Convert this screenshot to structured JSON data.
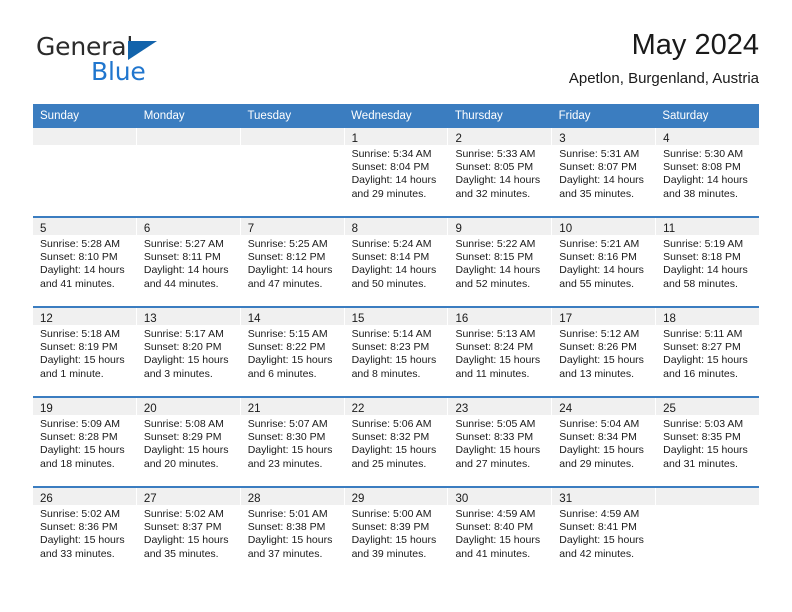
{
  "logo": {
    "word_top": "General",
    "word_bottom": "Blue",
    "triangle_color": "#1263ab",
    "blue_text_color": "#2076ce"
  },
  "header": {
    "title": "May 2024",
    "subtitle": "Apetlon, Burgenland, Austria"
  },
  "colors": {
    "header_blue": "#3b7dc0",
    "day_band_gray": "#f0f0f0",
    "text": "#1a1a1a"
  },
  "weekdays": [
    "Sunday",
    "Monday",
    "Tuesday",
    "Wednesday",
    "Thursday",
    "Friday",
    "Saturday"
  ],
  "weeks": [
    [
      {
        "day": "",
        "empty": true
      },
      {
        "day": "",
        "empty": true
      },
      {
        "day": "",
        "empty": true
      },
      {
        "day": "1",
        "sunrise": "Sunrise: 5:34 AM",
        "sunset": "Sunset: 8:04 PM",
        "daylight_1": "Daylight: 14 hours",
        "daylight_2": "and 29 minutes."
      },
      {
        "day": "2",
        "sunrise": "Sunrise: 5:33 AM",
        "sunset": "Sunset: 8:05 PM",
        "daylight_1": "Daylight: 14 hours",
        "daylight_2": "and 32 minutes."
      },
      {
        "day": "3",
        "sunrise": "Sunrise: 5:31 AM",
        "sunset": "Sunset: 8:07 PM",
        "daylight_1": "Daylight: 14 hours",
        "daylight_2": "and 35 minutes."
      },
      {
        "day": "4",
        "sunrise": "Sunrise: 5:30 AM",
        "sunset": "Sunset: 8:08 PM",
        "daylight_1": "Daylight: 14 hours",
        "daylight_2": "and 38 minutes."
      }
    ],
    [
      {
        "day": "5",
        "sunrise": "Sunrise: 5:28 AM",
        "sunset": "Sunset: 8:10 PM",
        "daylight_1": "Daylight: 14 hours",
        "daylight_2": "and 41 minutes."
      },
      {
        "day": "6",
        "sunrise": "Sunrise: 5:27 AM",
        "sunset": "Sunset: 8:11 PM",
        "daylight_1": "Daylight: 14 hours",
        "daylight_2": "and 44 minutes."
      },
      {
        "day": "7",
        "sunrise": "Sunrise: 5:25 AM",
        "sunset": "Sunset: 8:12 PM",
        "daylight_1": "Daylight: 14 hours",
        "daylight_2": "and 47 minutes."
      },
      {
        "day": "8",
        "sunrise": "Sunrise: 5:24 AM",
        "sunset": "Sunset: 8:14 PM",
        "daylight_1": "Daylight: 14 hours",
        "daylight_2": "and 50 minutes."
      },
      {
        "day": "9",
        "sunrise": "Sunrise: 5:22 AM",
        "sunset": "Sunset: 8:15 PM",
        "daylight_1": "Daylight: 14 hours",
        "daylight_2": "and 52 minutes."
      },
      {
        "day": "10",
        "sunrise": "Sunrise: 5:21 AM",
        "sunset": "Sunset: 8:16 PM",
        "daylight_1": "Daylight: 14 hours",
        "daylight_2": "and 55 minutes."
      },
      {
        "day": "11",
        "sunrise": "Sunrise: 5:19 AM",
        "sunset": "Sunset: 8:18 PM",
        "daylight_1": "Daylight: 14 hours",
        "daylight_2": "and 58 minutes."
      }
    ],
    [
      {
        "day": "12",
        "sunrise": "Sunrise: 5:18 AM",
        "sunset": "Sunset: 8:19 PM",
        "daylight_1": "Daylight: 15 hours",
        "daylight_2": "and 1 minute."
      },
      {
        "day": "13",
        "sunrise": "Sunrise: 5:17 AM",
        "sunset": "Sunset: 8:20 PM",
        "daylight_1": "Daylight: 15 hours",
        "daylight_2": "and 3 minutes."
      },
      {
        "day": "14",
        "sunrise": "Sunrise: 5:15 AM",
        "sunset": "Sunset: 8:22 PM",
        "daylight_1": "Daylight: 15 hours",
        "daylight_2": "and 6 minutes."
      },
      {
        "day": "15",
        "sunrise": "Sunrise: 5:14 AM",
        "sunset": "Sunset: 8:23 PM",
        "daylight_1": "Daylight: 15 hours",
        "daylight_2": "and 8 minutes."
      },
      {
        "day": "16",
        "sunrise": "Sunrise: 5:13 AM",
        "sunset": "Sunset: 8:24 PM",
        "daylight_1": "Daylight: 15 hours",
        "daylight_2": "and 11 minutes."
      },
      {
        "day": "17",
        "sunrise": "Sunrise: 5:12 AM",
        "sunset": "Sunset: 8:26 PM",
        "daylight_1": "Daylight: 15 hours",
        "daylight_2": "and 13 minutes."
      },
      {
        "day": "18",
        "sunrise": "Sunrise: 5:11 AM",
        "sunset": "Sunset: 8:27 PM",
        "daylight_1": "Daylight: 15 hours",
        "daylight_2": "and 16 minutes."
      }
    ],
    [
      {
        "day": "19",
        "sunrise": "Sunrise: 5:09 AM",
        "sunset": "Sunset: 8:28 PM",
        "daylight_1": "Daylight: 15 hours",
        "daylight_2": "and 18 minutes."
      },
      {
        "day": "20",
        "sunrise": "Sunrise: 5:08 AM",
        "sunset": "Sunset: 8:29 PM",
        "daylight_1": "Daylight: 15 hours",
        "daylight_2": "and 20 minutes."
      },
      {
        "day": "21",
        "sunrise": "Sunrise: 5:07 AM",
        "sunset": "Sunset: 8:30 PM",
        "daylight_1": "Daylight: 15 hours",
        "daylight_2": "and 23 minutes."
      },
      {
        "day": "22",
        "sunrise": "Sunrise: 5:06 AM",
        "sunset": "Sunset: 8:32 PM",
        "daylight_1": "Daylight: 15 hours",
        "daylight_2": "and 25 minutes."
      },
      {
        "day": "23",
        "sunrise": "Sunrise: 5:05 AM",
        "sunset": "Sunset: 8:33 PM",
        "daylight_1": "Daylight: 15 hours",
        "daylight_2": "and 27 minutes."
      },
      {
        "day": "24",
        "sunrise": "Sunrise: 5:04 AM",
        "sunset": "Sunset: 8:34 PM",
        "daylight_1": "Daylight: 15 hours",
        "daylight_2": "and 29 minutes."
      },
      {
        "day": "25",
        "sunrise": "Sunrise: 5:03 AM",
        "sunset": "Sunset: 8:35 PM",
        "daylight_1": "Daylight: 15 hours",
        "daylight_2": "and 31 minutes."
      }
    ],
    [
      {
        "day": "26",
        "sunrise": "Sunrise: 5:02 AM",
        "sunset": "Sunset: 8:36 PM",
        "daylight_1": "Daylight: 15 hours",
        "daylight_2": "and 33 minutes."
      },
      {
        "day": "27",
        "sunrise": "Sunrise: 5:02 AM",
        "sunset": "Sunset: 8:37 PM",
        "daylight_1": "Daylight: 15 hours",
        "daylight_2": "and 35 minutes."
      },
      {
        "day": "28",
        "sunrise": "Sunrise: 5:01 AM",
        "sunset": "Sunset: 8:38 PM",
        "daylight_1": "Daylight: 15 hours",
        "daylight_2": "and 37 minutes."
      },
      {
        "day": "29",
        "sunrise": "Sunrise: 5:00 AM",
        "sunset": "Sunset: 8:39 PM",
        "daylight_1": "Daylight: 15 hours",
        "daylight_2": "and 39 minutes."
      },
      {
        "day": "30",
        "sunrise": "Sunrise: 4:59 AM",
        "sunset": "Sunset: 8:40 PM",
        "daylight_1": "Daylight: 15 hours",
        "daylight_2": "and 41 minutes."
      },
      {
        "day": "31",
        "sunrise": "Sunrise: 4:59 AM",
        "sunset": "Sunset: 8:41 PM",
        "daylight_1": "Daylight: 15 hours",
        "daylight_2": "and 42 minutes."
      },
      {
        "day": "",
        "empty": true
      }
    ]
  ]
}
